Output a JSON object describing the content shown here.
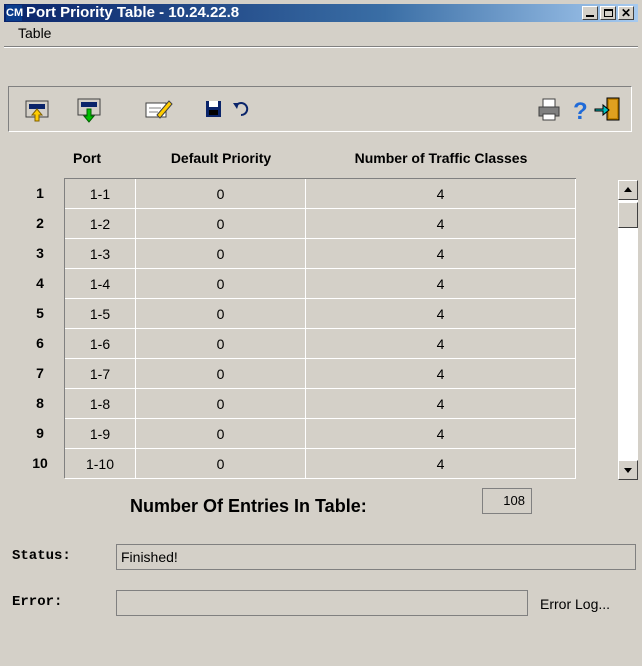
{
  "window": {
    "title": "Port Priority Table - 10.24.22.8",
    "icon_text": "CM"
  },
  "menu": {
    "items": [
      "Table"
    ]
  },
  "toolbar": {
    "buttons": [
      "upload-icon",
      "download-icon",
      "edit-icon",
      "save-icon",
      "undo-icon",
      "print-icon",
      "help-icon",
      "exit-icon"
    ]
  },
  "table": {
    "columns": [
      "Port",
      "Default Priority",
      "Number of Traffic Classes"
    ],
    "rows": [
      {
        "num": "1",
        "port": "1-1",
        "priority": "0",
        "classes": "4"
      },
      {
        "num": "2",
        "port": "1-2",
        "priority": "0",
        "classes": "4"
      },
      {
        "num": "3",
        "port": "1-3",
        "priority": "0",
        "classes": "4"
      },
      {
        "num": "4",
        "port": "1-4",
        "priority": "0",
        "classes": "4"
      },
      {
        "num": "5",
        "port": "1-5",
        "priority": "0",
        "classes": "4"
      },
      {
        "num": "6",
        "port": "1-6",
        "priority": "0",
        "classes": "4"
      },
      {
        "num": "7",
        "port": "1-7",
        "priority": "0",
        "classes": "4"
      },
      {
        "num": "8",
        "port": "1-8",
        "priority": "0",
        "classes": "4"
      },
      {
        "num": "9",
        "port": "1-9",
        "priority": "0",
        "classes": "4"
      },
      {
        "num": "10",
        "port": "1-10",
        "priority": "0",
        "classes": "4"
      }
    ]
  },
  "entries": {
    "label": "Number Of Entries In Table:",
    "value": "108"
  },
  "status": {
    "label": "Status:",
    "value": "Finished!"
  },
  "error": {
    "label": "Error:",
    "value": "",
    "log_label": "Error Log..."
  }
}
